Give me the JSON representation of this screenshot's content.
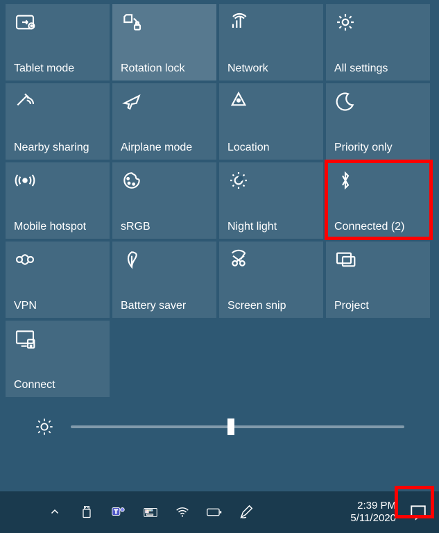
{
  "tiles": [
    {
      "id": "tablet-mode",
      "label": "Tablet mode",
      "icon": "tablet-mode-icon",
      "active": false
    },
    {
      "id": "rotation-lock",
      "label": "Rotation lock",
      "icon": "rotation-lock-icon",
      "active": true
    },
    {
      "id": "network",
      "label": "Network",
      "icon": "network-icon",
      "active": false
    },
    {
      "id": "all-settings",
      "label": "All settings",
      "icon": "settings-gear-icon",
      "active": false
    },
    {
      "id": "nearby-sharing",
      "label": "Nearby sharing",
      "icon": "nearby-sharing-icon",
      "active": false
    },
    {
      "id": "airplane-mode",
      "label": "Airplane mode",
      "icon": "airplane-mode-icon",
      "active": false
    },
    {
      "id": "location",
      "label": "Location",
      "icon": "location-icon",
      "active": false
    },
    {
      "id": "priority-only",
      "label": "Priority only",
      "icon": "quiet-hours-moon-icon",
      "active": false
    },
    {
      "id": "mobile-hotspot",
      "label": "Mobile hotspot",
      "icon": "mobile-hotspot-icon",
      "active": false
    },
    {
      "id": "srgb",
      "label": "sRGB",
      "icon": "color-palette-icon",
      "active": false
    },
    {
      "id": "night-light",
      "label": "Night light",
      "icon": "night-light-icon",
      "active": false
    },
    {
      "id": "bluetooth",
      "label": "Connected (2)",
      "icon": "bluetooth-icon",
      "active": false,
      "highlight": true
    },
    {
      "id": "vpn",
      "label": "VPN",
      "icon": "vpn-icon",
      "active": false
    },
    {
      "id": "battery-saver",
      "label": "Battery saver",
      "icon": "battery-saver-leaf-icon",
      "active": false
    },
    {
      "id": "screen-snip",
      "label": "Screen snip",
      "icon": "screen-snip-icon",
      "active": false
    },
    {
      "id": "project",
      "label": "Project",
      "icon": "project-screen-icon",
      "active": false
    },
    {
      "id": "connect",
      "label": "Connect",
      "icon": "connect-cast-icon",
      "active": false
    }
  ],
  "brightness": {
    "value": 48
  },
  "taskbar": {
    "time": "2:39 PM",
    "date": "5/11/2020"
  }
}
